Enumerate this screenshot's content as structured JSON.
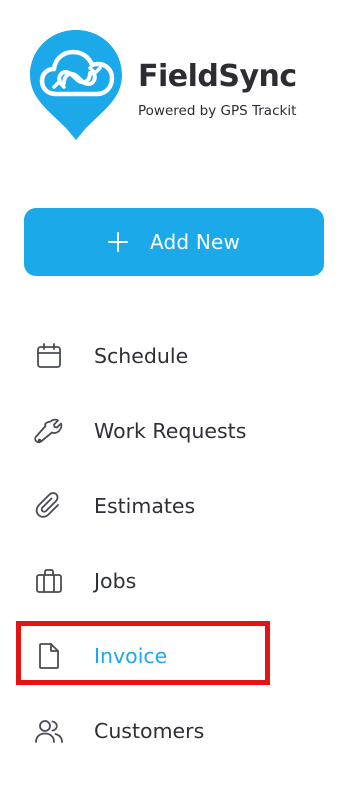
{
  "brand": {
    "name": "FieldSync",
    "tagline": "Powered by GPS Trackit",
    "logo_icon": "cloud-sync-pin-logo",
    "color": "#1ba9ea"
  },
  "add_new": {
    "label": "Add New",
    "icon": "plus-icon"
  },
  "nav": {
    "items": [
      {
        "label": "Schedule",
        "icon": "calendar-icon",
        "active": false
      },
      {
        "label": "Work Requests",
        "icon": "wrench-icon",
        "active": false
      },
      {
        "label": "Estimates",
        "icon": "paperclip-icon",
        "active": false
      },
      {
        "label": "Jobs",
        "icon": "briefcase-icon",
        "active": false
      },
      {
        "label": "Invoice",
        "icon": "document-icon",
        "active": true
      },
      {
        "label": "Customers",
        "icon": "users-icon",
        "active": false
      }
    ]
  },
  "colors": {
    "accent": "#1ba9ea",
    "text": "#2e3037",
    "highlight": "#e51313"
  }
}
